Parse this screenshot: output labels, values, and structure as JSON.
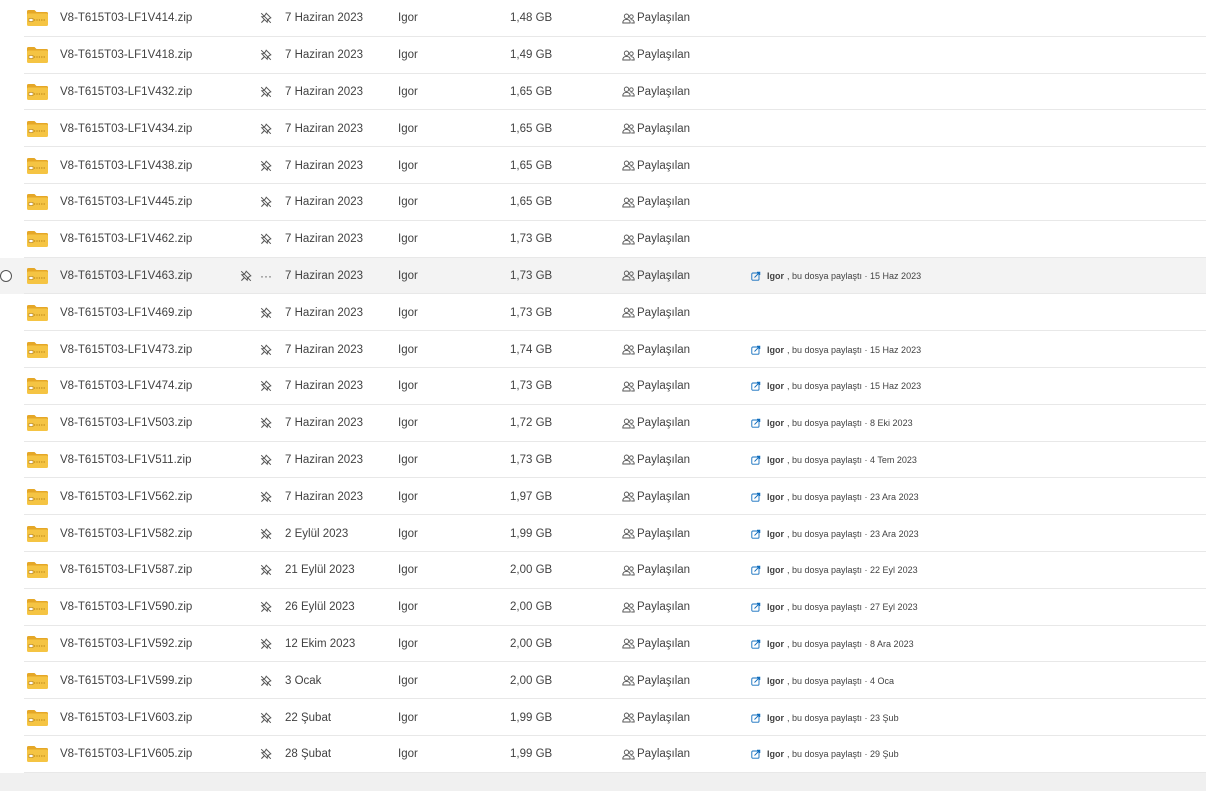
{
  "shared_label": "Paylaşılan",
  "icons": {
    "file": "zip-folder-icon",
    "pin": "pin-off-icon",
    "more": "more-horizontal-icon",
    "shared": "people-icon",
    "activity": "share-activity-icon",
    "select": "radio-circle"
  },
  "colors": {
    "folder": "#f5c443",
    "folder_dark": "#e5a727",
    "activity_icon": "#0f6cbd",
    "selected_row": "#f3f3f3"
  },
  "files": [
    {
      "name": "V8-T615T03-LF1V414.zip",
      "date": "7 Haziran 2023",
      "owner": "Igor",
      "size": "1,48 GB",
      "activity": null
    },
    {
      "name": "V8-T615T03-LF1V418.zip",
      "date": "7 Haziran 2023",
      "owner": "Igor",
      "size": "1,49 GB",
      "activity": null
    },
    {
      "name": "V8-T615T03-LF1V432.zip",
      "date": "7 Haziran 2023",
      "owner": "Igor",
      "size": "1,65 GB",
      "activity": null
    },
    {
      "name": "V8-T615T03-LF1V434.zip",
      "date": "7 Haziran 2023",
      "owner": "Igor",
      "size": "1,65 GB",
      "activity": null
    },
    {
      "name": "V8-T615T03-LF1V438.zip",
      "date": "7 Haziran 2023",
      "owner": "Igor",
      "size": "1,65 GB",
      "activity": null
    },
    {
      "name": "V8-T615T03-LF1V445.zip",
      "date": "7 Haziran 2023",
      "owner": "Igor",
      "size": "1,65 GB",
      "activity": null
    },
    {
      "name": "V8-T615T03-LF1V462.zip",
      "date": "7 Haziran 2023",
      "owner": "Igor",
      "size": "1,73 GB",
      "activity": null
    },
    {
      "name": "V8-T615T03-LF1V463.zip",
      "date": "7 Haziran 2023",
      "owner": "Igor",
      "size": "1,73 GB",
      "selected": true,
      "activity": {
        "user": "Igor",
        "text": ", bu dosya paylaştı · 15 Haz 2023"
      }
    },
    {
      "name": "V8-T615T03-LF1V469.zip",
      "date": "7 Haziran 2023",
      "owner": "Igor",
      "size": "1,73 GB",
      "activity": null
    },
    {
      "name": "V8-T615T03-LF1V473.zip",
      "date": "7 Haziran 2023",
      "owner": "Igor",
      "size": "1,74 GB",
      "activity": {
        "user": "Igor",
        "text": ", bu dosya paylaştı · 15 Haz 2023"
      }
    },
    {
      "name": "V8-T615T03-LF1V474.zip",
      "date": "7 Haziran 2023",
      "owner": "Igor",
      "size": "1,73 GB",
      "activity": {
        "user": "Igor",
        "text": ", bu dosya paylaştı · 15 Haz 2023"
      }
    },
    {
      "name": "V8-T615T03-LF1V503.zip",
      "date": "7 Haziran 2023",
      "owner": "Igor",
      "size": "1,72 GB",
      "activity": {
        "user": "Igor",
        "text": ", bu dosya paylaştı · 8 Eki 2023"
      }
    },
    {
      "name": "V8-T615T03-LF1V511.zip",
      "date": "7 Haziran 2023",
      "owner": "Igor",
      "size": "1,73 GB",
      "activity": {
        "user": "Igor",
        "text": ", bu dosya paylaştı · 4 Tem 2023"
      }
    },
    {
      "name": "V8-T615T03-LF1V562.zip",
      "date": "7 Haziran 2023",
      "owner": "Igor",
      "size": "1,97 GB",
      "activity": {
        "user": "Igor",
        "text": ", bu dosya paylaştı · 23 Ara 2023"
      }
    },
    {
      "name": "V8-T615T03-LF1V582.zip",
      "date": "2 Eylül 2023",
      "owner": "Igor",
      "size": "1,99 GB",
      "activity": {
        "user": "Igor",
        "text": ", bu dosya paylaştı · 23 Ara 2023"
      }
    },
    {
      "name": "V8-T615T03-LF1V587.zip",
      "date": "21 Eylül 2023",
      "owner": "Igor",
      "size": "2,00 GB",
      "activity": {
        "user": "Igor",
        "text": ", bu dosya paylaştı · 22 Eyl 2023"
      }
    },
    {
      "name": "V8-T615T03-LF1V590.zip",
      "date": "26 Eylül 2023",
      "owner": "Igor",
      "size": "2,00 GB",
      "activity": {
        "user": "Igor",
        "text": ", bu dosya paylaştı · 27 Eyl 2023"
      }
    },
    {
      "name": "V8-T615T03-LF1V592.zip",
      "date": "12 Ekim 2023",
      "owner": "Igor",
      "size": "2,00 GB",
      "activity": {
        "user": "Igor",
        "text": ", bu dosya paylaştı · 8 Ara 2023"
      }
    },
    {
      "name": "V8-T615T03-LF1V599.zip",
      "date": "3 Ocak",
      "owner": "Igor",
      "size": "2,00 GB",
      "activity": {
        "user": "Igor",
        "text": ", bu dosya paylaştı · 4 Oca"
      }
    },
    {
      "name": "V8-T615T03-LF1V603.zip",
      "date": "22 Şubat",
      "owner": "Igor",
      "size": "1,99 GB",
      "activity": {
        "user": "Igor",
        "text": ", bu dosya paylaştı · 23 Şub"
      }
    },
    {
      "name": "V8-T615T03-LF1V605.zip",
      "date": "28 Şubat",
      "owner": "Igor",
      "size": "1,99 GB",
      "activity": {
        "user": "Igor",
        "text": ", bu dosya paylaştı · 29 Şub"
      }
    }
  ]
}
